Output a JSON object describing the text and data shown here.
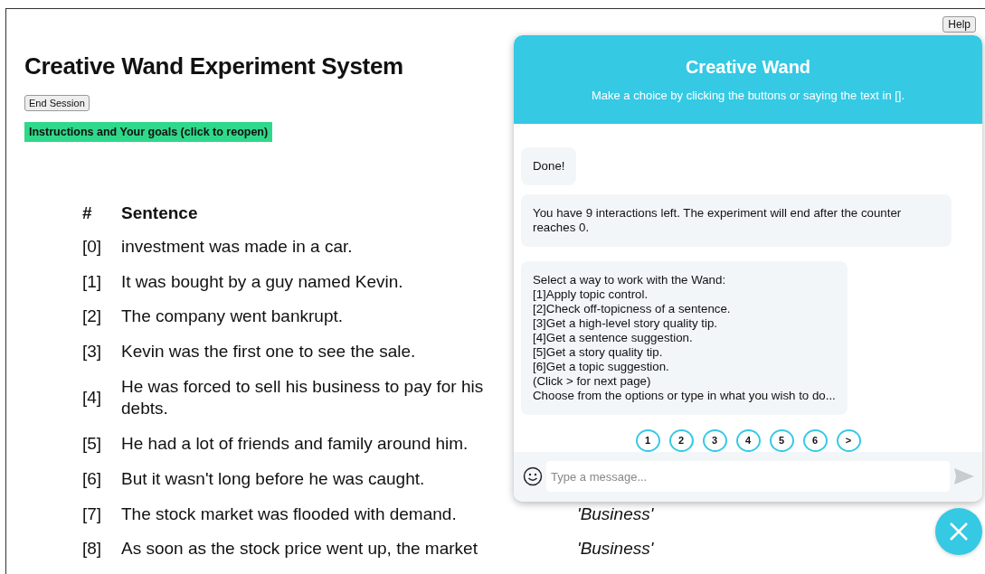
{
  "page": {
    "title": "Creative Wand Experiment System",
    "help_button": "Help",
    "end_session_button": "End Session",
    "instructions_banner": "Instructions and Your goals (click to reopen)"
  },
  "table": {
    "columns": [
      "#",
      "Sentence"
    ],
    "rows": [
      {
        "index": "[0]",
        "sentence": "investment was made in a car."
      },
      {
        "index": "[1]",
        "sentence": "It was bought by a guy named Kevin."
      },
      {
        "index": "[2]",
        "sentence": "The company went bankrupt."
      },
      {
        "index": "[3]",
        "sentence": "Kevin was the first one to see the sale."
      },
      {
        "index": "[4]",
        "sentence": "He was forced to sell his business to pay for his debts."
      },
      {
        "index": "[5]",
        "sentence": "He had a lot of friends and family around him."
      },
      {
        "index": "[6]",
        "sentence": "But it wasn't long before he was caught."
      },
      {
        "index": "[7]",
        "sentence": "The stock market was flooded with demand.",
        "column_3": "'Business'"
      },
      {
        "index": "[8]",
        "sentence": "As soon as the stock price went up, the market",
        "column_3": "'Business'"
      }
    ]
  },
  "chat": {
    "title": "Creative Wand",
    "subtitle": "Make a choice by clicking the buttons or saying the text in [].",
    "messages": [
      {
        "lines": [
          "Done!"
        ]
      },
      {
        "lines": [
          "You have 9 interactions left. The experiment will end after the counter reaches 0."
        ]
      },
      {
        "lines": [
          "Select a way to work with the Wand:",
          "[1]Apply topic control.",
          "[2]Check off-topicness of a sentence.",
          "[3]Get a high-level story quality tip.",
          "[4]Get a sentence suggestion.",
          "[5]Get a story quality tip.",
          "[6]Get a topic suggestion.",
          "(Click > for next page)",
          "Choose from the options or type in what you wish to do..."
        ]
      }
    ],
    "quick_replies": [
      "1",
      "2",
      "3",
      "4",
      "5",
      "6",
      ">"
    ],
    "input": {
      "placeholder": "Type a message..."
    }
  }
}
